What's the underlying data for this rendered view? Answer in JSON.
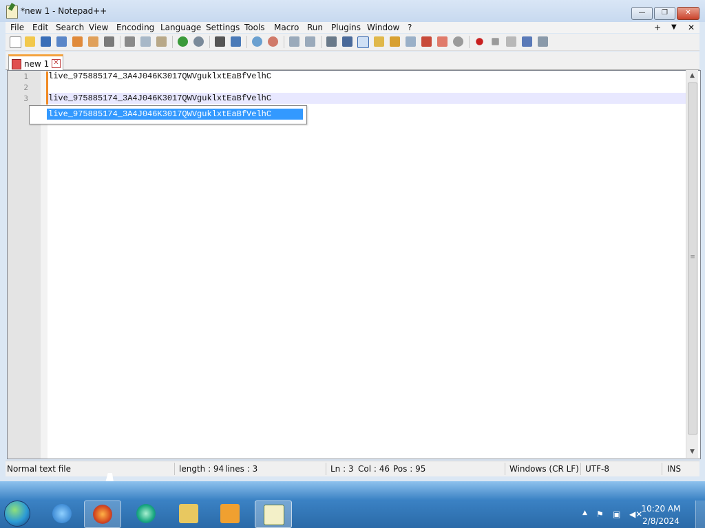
{
  "window": {
    "title": "*new 1 - Notepad++",
    "min": "—",
    "max": "❐",
    "close": "✕"
  },
  "menu": [
    "File",
    "Edit",
    "Search",
    "View",
    "Encoding",
    "Language",
    "Settings",
    "Tools",
    "Macro",
    "Run",
    "Plugins",
    "Window",
    "?"
  ],
  "menu_right": {
    "plus": "+",
    "dropdown": "▼",
    "close": "✕"
  },
  "tab": {
    "label": "new 1",
    "close": "✕"
  },
  "editor": {
    "lines": [
      {
        "num": "1",
        "text": "live_975885174_3A4J046K3017QWVguklxtEaBfVelhC"
      },
      {
        "num": "2",
        "text": ""
      },
      {
        "num": "3",
        "text": "live_975885174_3A4J046K3017QWVguklxtEaBfVelhC"
      }
    ],
    "autocomplete": "live_975885174_3A4J046K3017QWVguklxtEaBfVelhC"
  },
  "status": {
    "filetype": "Normal text file",
    "length": "length : 94",
    "lines": "lines : 3",
    "ln": "Ln : 3",
    "col": "Col : 46",
    "pos": "Pos : 95",
    "eol": "Windows (CR LF)",
    "encoding": "UTF-8",
    "mode": "INS"
  },
  "taskbar": {
    "time": "10:20 AM",
    "date": "2/8/2024"
  },
  "colors": {
    "accent": "#3399ff",
    "change_bar": "#f08a24",
    "caret_line": "#e8e8ff"
  }
}
